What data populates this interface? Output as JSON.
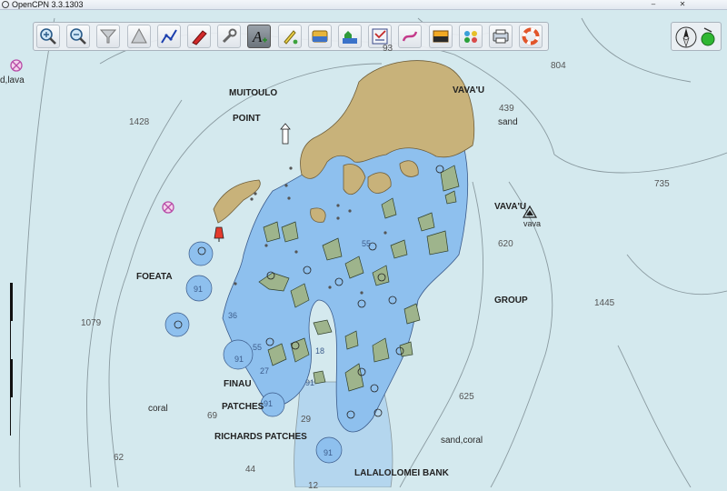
{
  "window": {
    "title": "OpenCPN 3.3.1303",
    "min": "–",
    "close": "✕"
  },
  "toolbar": [
    {
      "name": "zoom-in",
      "title": "Zoom In",
      "icon": "zoom-in-icon"
    },
    {
      "name": "zoom-out",
      "title": "Zoom Out",
      "icon": "zoom-out-icon"
    },
    {
      "name": "scale-in",
      "title": "Shift to Larger Scale Chart",
      "icon": "funnel-down-icon"
    },
    {
      "name": "scale-out",
      "title": "Shift to Smaller Scale Chart",
      "icon": "funnel-up-icon"
    },
    {
      "name": "route",
      "title": "Create Route",
      "icon": "route-icon"
    },
    {
      "name": "follow",
      "title": "Auto Follow",
      "icon": "boat-icon"
    },
    {
      "name": "settings",
      "title": "ToolBox",
      "icon": "wrench-icon"
    },
    {
      "name": "text",
      "title": "Show ENC Text",
      "icon": "text-a-icon",
      "active": true
    },
    {
      "name": "current",
      "title": "Show Currents",
      "icon": "current-icon"
    },
    {
      "name": "tide",
      "title": "Show Tides",
      "icon": "tide-icon"
    },
    {
      "name": "quilt",
      "title": "Enable Chart Quilting",
      "icon": "quilt-icon"
    },
    {
      "name": "route-manager",
      "title": "Route & Mark Manager",
      "icon": "list-icon"
    },
    {
      "name": "track",
      "title": "Enable Tracking",
      "icon": "track-icon"
    },
    {
      "name": "color-scheme",
      "title": "Change Color Scheme",
      "icon": "color-scheme-icon"
    },
    {
      "name": "ais",
      "title": "AIS",
      "icon": "ais-icon"
    },
    {
      "name": "chart-print",
      "title": "Print Chart",
      "icon": "printer-icon"
    },
    {
      "name": "help",
      "title": "About OpenCPN",
      "icon": "lifebuoy-icon"
    }
  ],
  "labels": [
    {
      "id": "muitoulo",
      "text": "MUITOULO"
    },
    {
      "id": "point",
      "text": "POINT"
    },
    {
      "id": "vavau1",
      "text": "VAVA'U"
    },
    {
      "id": "vavau2",
      "text": "VAVA'U"
    },
    {
      "id": "vava",
      "text": "vava"
    },
    {
      "id": "group",
      "text": "GROUP"
    },
    {
      "id": "foeata",
      "text": "FOEATA"
    },
    {
      "id": "finau",
      "text": "FINAU"
    },
    {
      "id": "patches",
      "text": "PATCHES"
    },
    {
      "id": "richards",
      "text": "RICHARDS PATCHES"
    },
    {
      "id": "lalalolomei",
      "text": "LALALOLOMEI BANK"
    },
    {
      "id": "sandcoral",
      "text": "sand,coral"
    },
    {
      "id": "coral",
      "text": "coral"
    },
    {
      "id": "sand",
      "text": "sand"
    },
    {
      "id": "dlava",
      "text": "d,lava"
    }
  ],
  "soundings": [
    {
      "id": "s93",
      "text": "93"
    },
    {
      "id": "s804",
      "text": "804"
    },
    {
      "id": "s1428",
      "text": "1428"
    },
    {
      "id": "s439",
      "text": "439"
    },
    {
      "id": "s735",
      "text": "735"
    },
    {
      "id": "s620",
      "text": "620"
    },
    {
      "id": "s1445",
      "text": "1445"
    },
    {
      "id": "s1079",
      "text": "1079"
    },
    {
      "id": "s625",
      "text": "625"
    },
    {
      "id": "s69",
      "text": "69"
    },
    {
      "id": "s62",
      "text": "62"
    },
    {
      "id": "s44",
      "text": "44"
    },
    {
      "id": "s29",
      "text": "29"
    },
    {
      "id": "s12",
      "text": "12"
    }
  ],
  "shallow_soundings": [
    {
      "id": "b55a",
      "text": "55"
    },
    {
      "id": "b91a",
      "text": "91"
    },
    {
      "id": "b36",
      "text": "36"
    },
    {
      "id": "b55b",
      "text": "55"
    },
    {
      "id": "b91b",
      "text": "91"
    },
    {
      "id": "b27",
      "text": "27"
    },
    {
      "id": "b91c",
      "text": "91"
    },
    {
      "id": "b18",
      "text": "18"
    },
    {
      "id": "b91d",
      "text": "91"
    },
    {
      "id": "b91e",
      "text": "91"
    }
  ],
  "colors": {
    "deep_water": "#d4e9ee",
    "shallow_water": "#8ec0ee",
    "mid_water": "#b4d6ee",
    "land": "#c8b27a",
    "reef": "#9eb48c",
    "contour": "#8a9aa0"
  }
}
